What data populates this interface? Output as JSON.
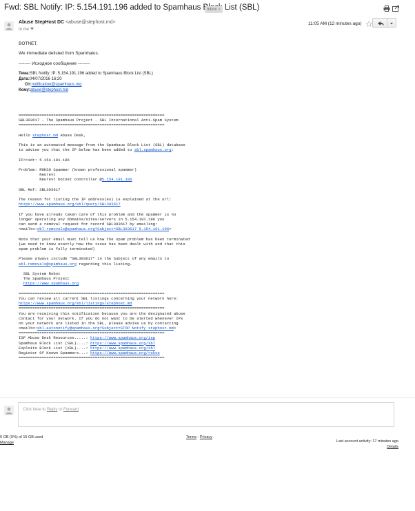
{
  "subject": {
    "title": "Fwd: SBL Notify: IP: 5.154.191.196 added to Spamhaus Block List (SBL)",
    "label": "Inbox",
    "label_close": "x"
  },
  "icons": {
    "print": "print-icon",
    "new_window": "new-window-icon",
    "avatar": "person-icon",
    "star": "star-icon",
    "reply": "reply-arrow-icon",
    "more": "chevron-down-icon"
  },
  "message": {
    "sender_name": "Abuse StepHost DC",
    "sender_email": "<abuse@stephost.md>",
    "to_line": "to me",
    "timestamp": "11:05 AM (12 minutes ago)",
    "intro": [
      "BOTNET.",
      "We immediate delisted from Spamhaius.",
      "-------- Исходное сообщение --------"
    ],
    "forwarded": {
      "subject_label": "Тема:",
      "subject_value": "SBL Notify: IP: 5.154.191.196 added to Spamhaus Block List (SBL)",
      "date_label": "Дата:",
      "date_value": "04/07/2016 16:20",
      "from_label": "От:",
      "from_value": "notification@spamhaus.org",
      "to_label": "Кому:",
      "to_value": "abuse@stephost.md"
    },
    "report_lines": [
      {
        "pre": "==============================================================="
      },
      {
        "pre": "SBL303617 - The Spamhaus Project - SBL International Anti-Spam System"
      },
      {
        "pre": "==============================================================="
      },
      {
        "pre": ""
      },
      {
        "pre": "Hello ",
        "link": "stephost.md",
        "post": " Abuse Desk,"
      },
      {
        "pre": ""
      },
      {
        "pre": "This is an automated message from the Spamhaus Block List (SBL) database"
      },
      {
        "pre": "to advise you that the IP below has been added to ",
        "link": "sbl.spamhaus.org",
        "post": ":"
      },
      {
        "pre": ""
      },
      {
        "pre": "IP/cidr: 5.154.191.196"
      },
      {
        "pre": ""
      },
      {
        "pre": "Problem: ROKSO Spammer (known professional spammer)"
      },
      {
        "pre": "         Neurevt"
      },
      {
        "pre": "         Neurevt botnet controller @",
        "link": "5.154.191.196",
        "post": ""
      },
      {
        "pre": ""
      },
      {
        "pre": "SBL Ref: SBL303617"
      },
      {
        "pre": ""
      },
      {
        "pre": "The reason for listing the IP address(es) is explained at the url:"
      },
      {
        "pre": "",
        "link": "https://www.spamhaus.org/sbl/query/SBL303617",
        "post": ""
      },
      {
        "pre": ""
      },
      {
        "pre": "If you have already taken care of this problem and the spammer is no"
      },
      {
        "pre": "longer operating any domains/sites/servers in 5.154.191.196 you"
      },
      {
        "pre": "can send a removal request for record SBL303617 by emailing:"
      },
      {
        "pre": "<mailto:",
        "link": "sbl-removals@spamhaus.org?Subject=SBL303617 5.154.191.196",
        "post": ">"
      },
      {
        "pre": ""
      },
      {
        "pre": "Note that your email must tell us how the spam problem has been terminated"
      },
      {
        "pre": "(we need to know exactly how the issue has been dealt with and that this"
      },
      {
        "pre": "spam problem is fully terminated)"
      },
      {
        "pre": ""
      },
      {
        "pre": "Please always include \"SBL303617\" in the Subject of any emails to"
      },
      {
        "pre": "",
        "link": "sbl-removals@spamhaus.org",
        "post": " regarding this listing."
      },
      {
        "pre": ""
      },
      {
        "pre": "  SBL System Robot"
      },
      {
        "pre": "  The Spamhaus Project"
      },
      {
        "pre": "  ",
        "link": "https://www.spamhaus.org",
        "post": ""
      },
      {
        "pre": ""
      },
      {
        "pre": "==============================================================="
      },
      {
        "pre": "You can review all current SBL listings concerning your network here:"
      },
      {
        "pre": "",
        "link": "https://www.spamhaus.org/sbl/listings/stephost.md",
        "post": ""
      },
      {
        "pre": "==============================================================="
      },
      {
        "pre": "You are receiving this notification because you are the designated abuse"
      },
      {
        "pre": "contact for your network. If you do not want to be alerted whenever IPs"
      },
      {
        "pre": "on your network are listed in the SBL, please advise us by contacting"
      },
      {
        "pre": "<mailto:",
        "link": "sbl-autonotify@spamhaus.org?Subject=STOP Notify stephost.md",
        "post": ">"
      },
      {
        "pre": "==============================================================="
      },
      {
        "pre": "ISP Abuse Desk Resources.....: ",
        "link": "https://www.spamhaus.org/isp",
        "post": ""
      },
      {
        "pre": "Spamhaus Block List (SBL)....: ",
        "link": "https://www.spamhaus.org/sbl",
        "post": ""
      },
      {
        "pre": "Exploits Block List (XBL)....: ",
        "link": "https://www.spamhaus.org/xbl",
        "post": ""
      },
      {
        "pre": "Register Of Known Spammers...: ",
        "link": "https://www.spamhaus.org/rokso",
        "post": ""
      },
      {
        "pre": "==============================================================="
      }
    ]
  },
  "reply_box": {
    "prefix": "Click here to ",
    "reply": "Reply",
    "or": " or ",
    "forward": "Forward"
  },
  "footer": {
    "storage": "0 GB (0%) of 15 GB used",
    "manage": "Manage",
    "terms": "Terms",
    "separator": " - ",
    "privacy": "Privacy",
    "activity": "Last account activity: 17 minutes ago",
    "details": "Details"
  }
}
